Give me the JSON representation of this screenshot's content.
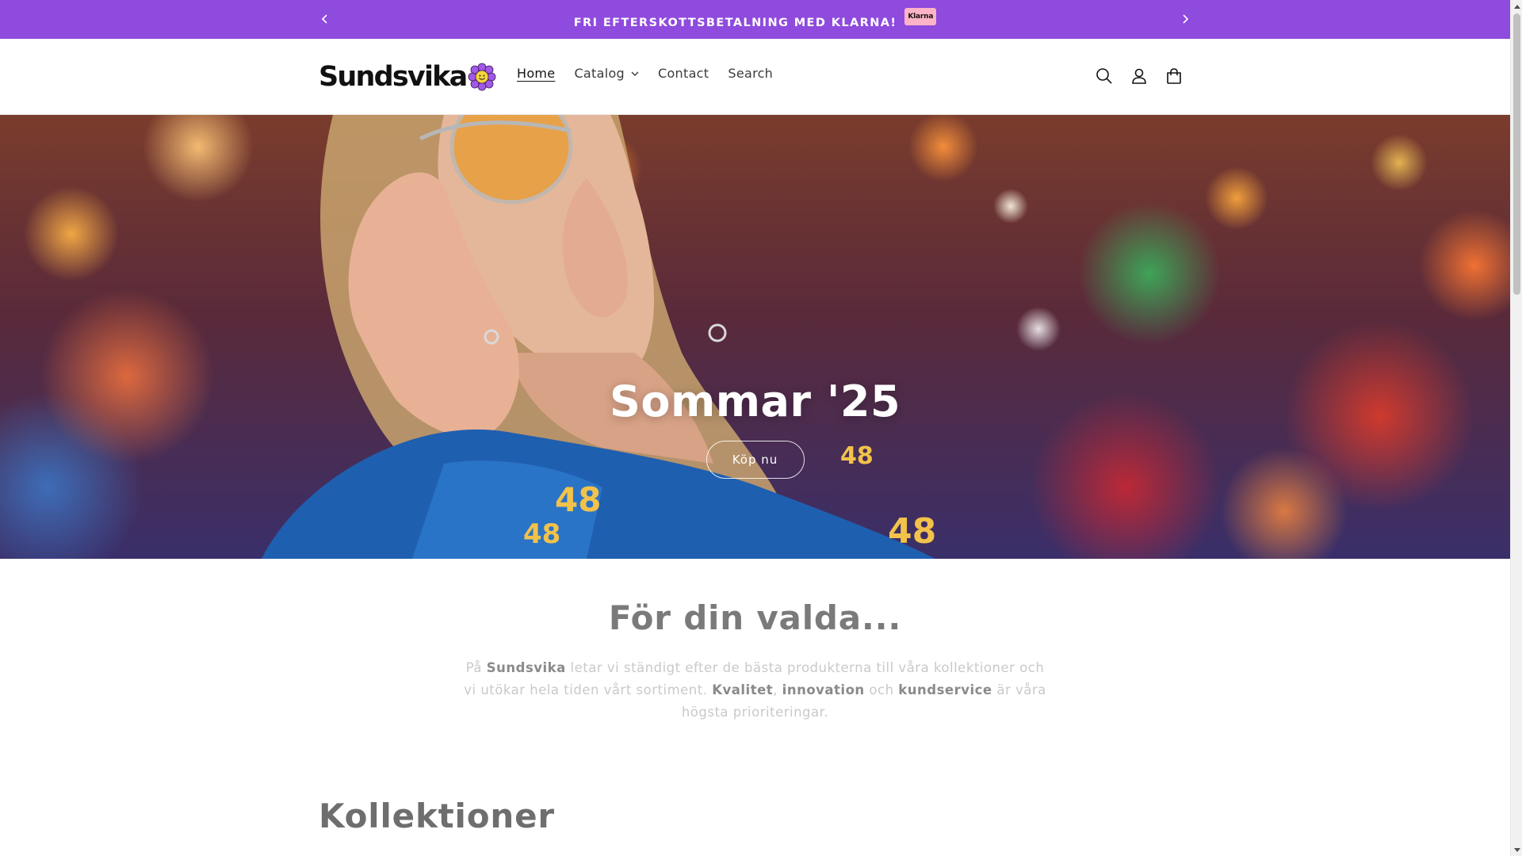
{
  "announcement": {
    "message": "FRI EFTERSKOTTSBETALNING MED KLARNA!",
    "badge": "Klarna",
    "prev_icon": "chevron-left-icon",
    "next_icon": "chevron-right-icon"
  },
  "header": {
    "logo_text": "Sundsvika",
    "nav": [
      {
        "label": "Home",
        "active": true
      },
      {
        "label": "Catalog",
        "has_dropdown": true
      },
      {
        "label": "Contact"
      },
      {
        "label": "Search"
      }
    ],
    "icons": [
      "search-icon",
      "account-icon",
      "cart-icon"
    ]
  },
  "hero": {
    "title": "Sommar '25",
    "button_label": "Köp nu"
  },
  "intro": {
    "title": "För din valda...",
    "text_parts": {
      "p1": "På ",
      "brand": "Sundsvika",
      "p2": " letar vi ständigt efter de bästa produkterna till våra kollektioner och vi utökar hela tiden vårt sortiment. ",
      "k1": "Kvalitet",
      "sep1": ", ",
      "k2": "innovation",
      "sep2": " och ",
      "k3": "kundservice",
      "p3": " är våra högsta prioriteringar."
    }
  },
  "collections": {
    "title": "Kollektioner"
  },
  "colors": {
    "announcement_bg": "#8f4ade",
    "klarna_pink": "#ffb3c7"
  }
}
